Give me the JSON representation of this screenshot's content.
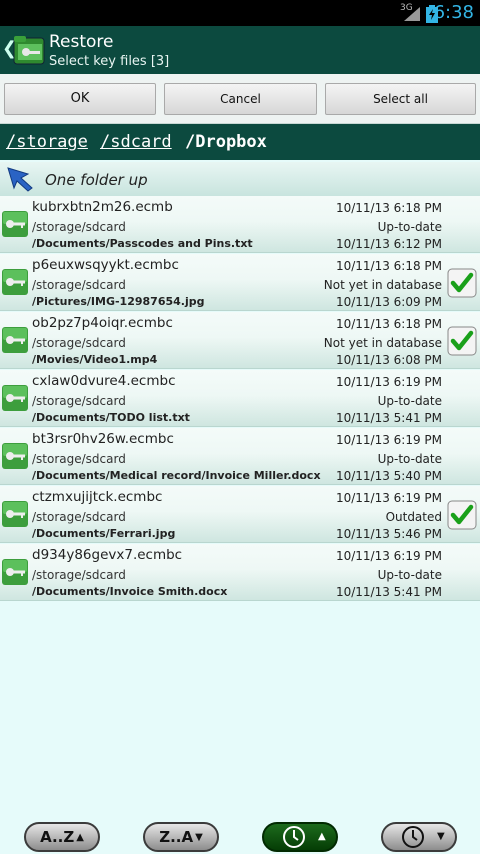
{
  "status_bar": {
    "network": "3G",
    "time": "6:38",
    "icons": [
      "signal-icon",
      "battery-charging-icon"
    ]
  },
  "action_bar": {
    "title": "Restore",
    "subtitle": "Select key files  [3]",
    "icon": "folder-key-icon"
  },
  "buttons": {
    "ok": "OK",
    "cancel": "Cancel",
    "select_all": "Select all"
  },
  "path": {
    "segments": [
      "/storage",
      "/sdcard"
    ],
    "current": "/Dropbox"
  },
  "folder_up": {
    "label": "One folder up",
    "icon": "arrow-up-left-icon"
  },
  "files": [
    {
      "name": "kubrxbtn2m26.ecmb",
      "date": "10/11/13 6:18 PM",
      "location": "/storage/sdcard",
      "status": "Up-to-date",
      "original": "/Documents/Passcodes and Pins.txt",
      "original_date": "10/11/13 6:12 PM",
      "checked": false
    },
    {
      "name": "p6euxwsqyykt.ecmbc",
      "date": "10/11/13 6:18 PM",
      "location": "/storage/sdcard",
      "status": "Not yet in database",
      "original": "/Pictures/IMG-12987654.jpg",
      "original_date": "10/11/13 6:09 PM",
      "checked": true
    },
    {
      "name": "ob2pz7p4oiqr.ecmbc",
      "date": "10/11/13 6:18 PM",
      "location": "/storage/sdcard",
      "status": "Not yet in database",
      "original": "/Movies/Video1.mp4",
      "original_date": "10/11/13 6:08 PM",
      "checked": true
    },
    {
      "name": "cxlaw0dvure4.ecmbc",
      "date": "10/11/13 6:19 PM",
      "location": "/storage/sdcard",
      "status": "Up-to-date",
      "original": "/Documents/TODO list.txt",
      "original_date": "10/11/13 5:41 PM",
      "checked": false
    },
    {
      "name": "bt3rsr0hv26w.ecmbc",
      "date": "10/11/13 6:19 PM",
      "location": "/storage/sdcard",
      "status": "Up-to-date",
      "original": "/Documents/Medical record/Invoice Miller.docx",
      "original_date": "10/11/13 5:40 PM",
      "checked": false
    },
    {
      "name": "ctzmxujijtck.ecmbc",
      "date": "10/11/13 6:19 PM",
      "location": "/storage/sdcard",
      "status": "Outdated",
      "original": "/Documents/Ferrari.jpg",
      "original_date": "10/11/13 5:46 PM",
      "checked": true
    },
    {
      "name": "d934y86gevx7.ecmbc",
      "date": "10/11/13 6:19 PM",
      "location": "/storage/sdcard",
      "status": "Up-to-date",
      "original": "/Documents/Invoice Smith.docx",
      "original_date": "10/11/13 5:41 PM",
      "checked": false
    }
  ],
  "sort_bar": {
    "az_label": "A..Z",
    "za_label": "Z..A",
    "icons": [
      "sort-az-icon",
      "sort-za-icon",
      "clock-ascending-icon",
      "clock-descending-icon"
    ],
    "active": "clock-ascending"
  },
  "colors": {
    "header_bg": "#0c4a3f",
    "list_bg": "#e6fbfa",
    "check_green": "#1aa01a",
    "status_accent": "#33b5e5"
  }
}
